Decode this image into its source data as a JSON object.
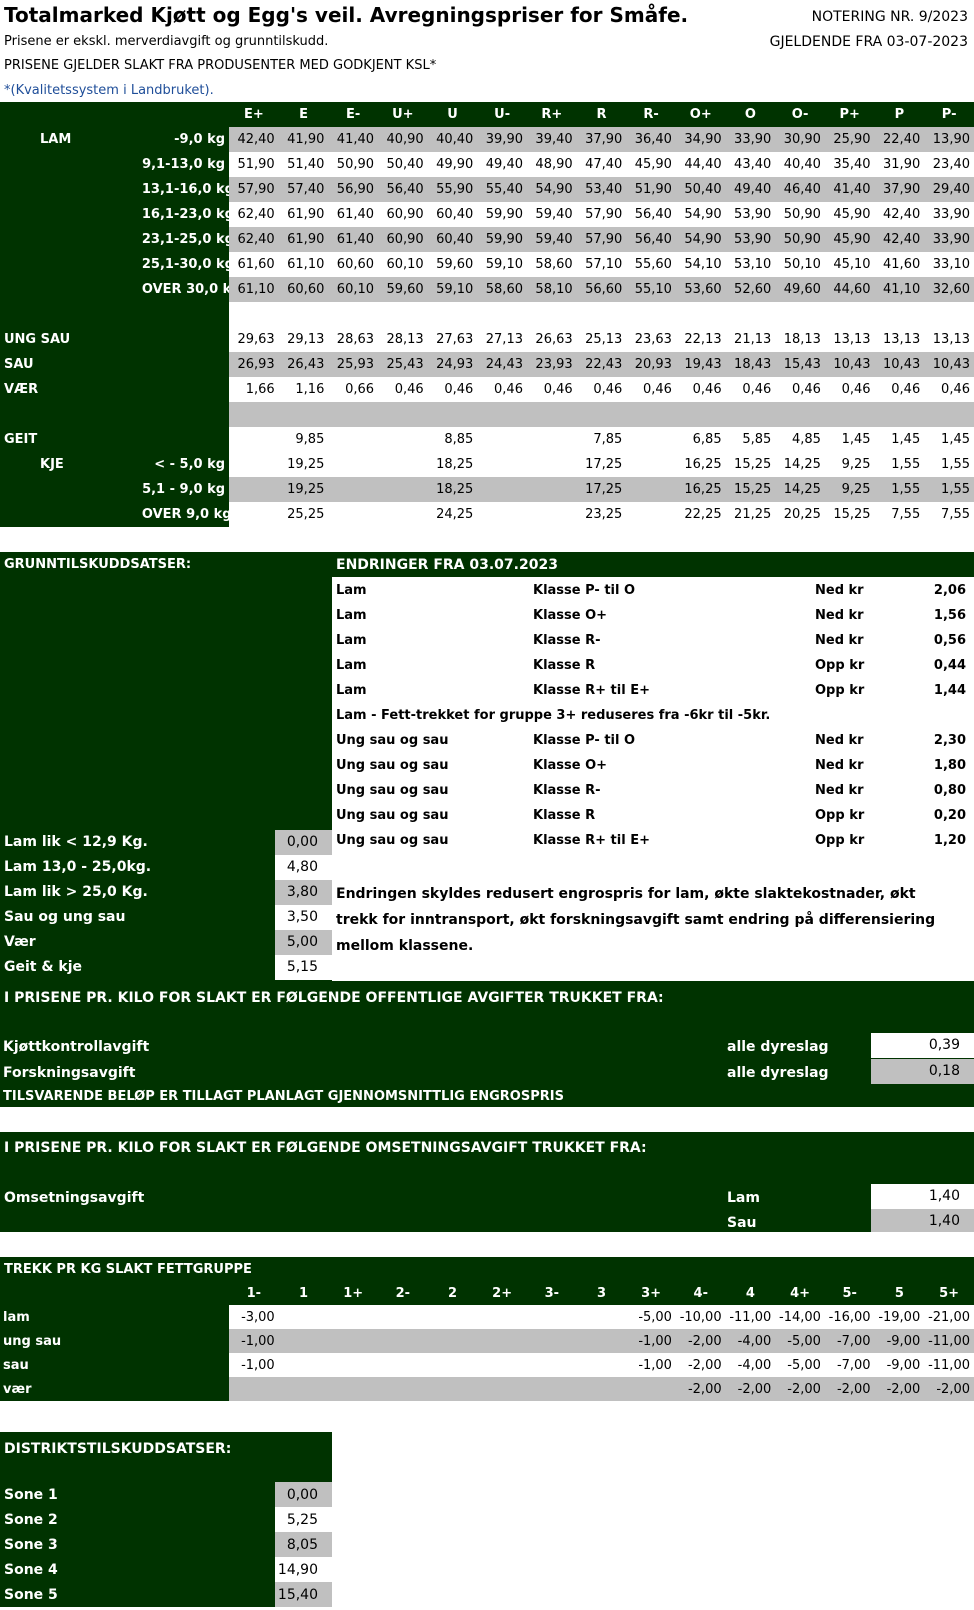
{
  "header": {
    "title": "Totalmarked Kjøtt og Egg's veil. Avregningspriser for Småfe.",
    "notering": "NOTERING NR. 9/2023",
    "gjeldende": "GJELDENDE FRA 03-07-2023",
    "sub1": "Prisene er ekskl. merverdiavgift og grunntilskudd.",
    "sub2": "PRISENE GJELDER SLAKT FRA PRODUSENTER MED GODKJENT KSL*",
    "sub3": "*(Kvalitetssystem i Landbruket)."
  },
  "prices": {
    "classes": [
      "E+",
      "E",
      "E-",
      "U+",
      "U",
      "U-",
      "R+",
      "R",
      "R-",
      "O+",
      "O",
      "O-",
      "P+",
      "P",
      "P-"
    ],
    "rows": [
      {
        "l1": "LAM",
        "l2": "-9,0 kg",
        "grey": true,
        "v": [
          "42,40",
          "41,90",
          "41,40",
          "40,90",
          "40,40",
          "39,90",
          "39,40",
          "37,90",
          "36,40",
          "34,90",
          "33,90",
          "30,90",
          "25,90",
          "22,40",
          "13,90"
        ]
      },
      {
        "l1": "",
        "l2": "9,1-13,0 kg",
        "grey": false,
        "v": [
          "51,90",
          "51,40",
          "50,90",
          "50,40",
          "49,90",
          "49,40",
          "48,90",
          "47,40",
          "45,90",
          "44,40",
          "43,40",
          "40,40",
          "35,40",
          "31,90",
          "23,40"
        ]
      },
      {
        "l1": "",
        "l2": "13,1-16,0 kg",
        "grey": true,
        "v": [
          "57,90",
          "57,40",
          "56,90",
          "56,40",
          "55,90",
          "55,40",
          "54,90",
          "53,40",
          "51,90",
          "50,40",
          "49,40",
          "46,40",
          "41,40",
          "37,90",
          "29,40"
        ]
      },
      {
        "l1": "",
        "l2": "16,1-23,0 kg",
        "grey": false,
        "v": [
          "62,40",
          "61,90",
          "61,40",
          "60,90",
          "60,40",
          "59,90",
          "59,40",
          "57,90",
          "56,40",
          "54,90",
          "53,90",
          "50,90",
          "45,90",
          "42,40",
          "33,90"
        ]
      },
      {
        "l1": "",
        "l2": "23,1-25,0 kg",
        "grey": true,
        "v": [
          "62,40",
          "61,90",
          "61,40",
          "60,90",
          "60,40",
          "59,90",
          "59,40",
          "57,90",
          "56,40",
          "54,90",
          "53,90",
          "50,90",
          "45,90",
          "42,40",
          "33,90"
        ]
      },
      {
        "l1": "",
        "l2": "25,1-30,0 kg",
        "grey": false,
        "v": [
          "61,60",
          "61,10",
          "60,60",
          "60,10",
          "59,60",
          "59,10",
          "58,60",
          "57,10",
          "55,60",
          "54,10",
          "53,10",
          "50,10",
          "45,10",
          "41,60",
          "33,10"
        ]
      },
      {
        "l1": "",
        "l2": "OVER 30,0 kg",
        "grey": true,
        "v": [
          "61,10",
          "60,60",
          "60,10",
          "59,60",
          "59,10",
          "58,60",
          "58,10",
          "56,60",
          "55,10",
          "53,60",
          "52,60",
          "49,60",
          "44,60",
          "41,10",
          "32,60"
        ]
      },
      {
        "l1": "",
        "l2": "",
        "grey": false,
        "v": [
          "",
          "",
          "",
          "",
          "",
          "",
          "",
          "",
          "",
          "",
          "",
          "",
          "",
          "",
          ""
        ]
      },
      {
        "l1": "UNG SAU",
        "l2": "",
        "grey": false,
        "v": [
          "29,63",
          "29,13",
          "28,63",
          "28,13",
          "27,63",
          "27,13",
          "26,63",
          "25,13",
          "23,63",
          "22,13",
          "21,13",
          "18,13",
          "13,13",
          "13,13",
          "13,13"
        ]
      },
      {
        "l1": "SAU",
        "l2": "",
        "grey": true,
        "v": [
          "26,93",
          "26,43",
          "25,93",
          "25,43",
          "24,93",
          "24,43",
          "23,93",
          "22,43",
          "20,93",
          "19,43",
          "18,43",
          "15,43",
          "10,43",
          "10,43",
          "10,43"
        ]
      },
      {
        "l1": "VÆR",
        "l2": "",
        "grey": false,
        "v": [
          "1,66",
          "1,16",
          "0,66",
          "0,46",
          "0,46",
          "0,46",
          "0,46",
          "0,46",
          "0,46",
          "0,46",
          "0,46",
          "0,46",
          "0,46",
          "0,46",
          "0,46"
        ]
      },
      {
        "l1": "",
        "l2": "",
        "grey": true,
        "v": [
          "",
          "",
          "",
          "",
          "",
          "",
          "",
          "",
          "",
          "",
          "",
          "",
          "",
          "",
          ""
        ]
      },
      {
        "l1": "GEIT",
        "l2": "",
        "grey": false,
        "v": [
          "",
          "9,85",
          "",
          "",
          "8,85",
          "",
          "",
          "7,85",
          "",
          "6,85",
          "5,85",
          "4,85",
          "1,45",
          "1,45",
          "1,45"
        ]
      },
      {
        "l1": "KJE",
        "l2": "< - 5,0 kg",
        "grey": false,
        "v": [
          "",
          "19,25",
          "",
          "",
          "18,25",
          "",
          "",
          "17,25",
          "",
          "16,25",
          "15,25",
          "14,25",
          "9,25",
          "1,55",
          "1,55"
        ]
      },
      {
        "l1": "",
        "l2": "5,1 - 9,0 kg",
        "grey": true,
        "v": [
          "",
          "19,25",
          "",
          "",
          "18,25",
          "",
          "",
          "17,25",
          "",
          "16,25",
          "15,25",
          "14,25",
          "9,25",
          "1,55",
          "1,55"
        ]
      },
      {
        "l1": "",
        "l2": "OVER 9,0 kg",
        "grey": false,
        "v": [
          "",
          "25,25",
          "",
          "",
          "24,25",
          "",
          "",
          "23,25",
          "",
          "22,25",
          "21,25",
          "20,25",
          "15,25",
          "7,55",
          "7,55"
        ]
      }
    ]
  },
  "grunn": {
    "title": "GRUNNTILSKUDDSATSER:",
    "endringer_title": "ENDRINGER FRA 03.07.2023",
    "changes": [
      {
        "a": "Lam",
        "b": "Klasse P- til O",
        "c": "Ned kr",
        "d": "2,06"
      },
      {
        "a": "Lam",
        "b": "Klasse O+",
        "c": "Ned kr",
        "d": "1,56"
      },
      {
        "a": "Lam",
        "b": "Klasse R-",
        "c": "Ned kr",
        "d": "0,56"
      },
      {
        "a": "Lam",
        "b": "Klasse R",
        "c": "Opp kr",
        "d": "0,44"
      },
      {
        "a": "Lam",
        "b": "Klasse R+ til E+",
        "c": "Opp kr",
        "d": "1,44"
      },
      {
        "a": "Lam - Fett-trekket for gruppe 3+ reduseres fra -6kr til -5kr.",
        "b": "",
        "c": "",
        "d": ""
      },
      {
        "a": "Ung sau og sau",
        "b": "Klasse P- til O",
        "c": "Ned kr",
        "d": "2,30"
      },
      {
        "a": "Ung sau og sau",
        "b": "Klasse O+",
        "c": "Ned kr",
        "d": "1,80"
      },
      {
        "a": "Ung sau og sau",
        "b": "Klasse R-",
        "c": "Ned kr",
        "d": "0,80"
      },
      {
        "a": "Ung sau og sau",
        "b": "Klasse R",
        "c": "Opp kr",
        "d": "0,20"
      },
      {
        "a": "Ung sau og sau",
        "b": "Klasse R+ til E+",
        "c": "Opp kr",
        "d": "1,20"
      }
    ],
    "rates": [
      {
        "label": "Lam lik < 12,9 Kg.",
        "value": "0,00",
        "grey": true
      },
      {
        "label": "Lam 13,0 - 25,0kg.",
        "value": "4,80",
        "grey": false
      },
      {
        "label": "Lam lik > 25,0 Kg.",
        "value": "3,80",
        "grey": true
      },
      {
        "label": "Sau og ung sau",
        "value": "3,50",
        "grey": false
      },
      {
        "label": "Vær",
        "value": "5,00",
        "grey": true
      },
      {
        "label": "Geit & kje",
        "value": "5,15",
        "grey": false
      }
    ],
    "note_lines": [
      "Endringen skyldes redusert engrospris for lam, økte slaktekostnader, økt",
      "trekk for inntransport, økt forskningsavgift samt endring på differensiering",
      "mellom klassene."
    ]
  },
  "avgifter": {
    "title": "I PRISENE PR. KILO FOR SLAKT ER FØLGENDE OFFENTLIGE AVGIFTER TRUKKET FRA:",
    "rows": [
      {
        "label": "Kjøttkontrollavgift",
        "scope": "alle dyreslag",
        "value": "0,39"
      },
      {
        "label": "Forskningsavgift",
        "scope": "alle dyreslag",
        "value": "0,18"
      }
    ],
    "footer": "TILSVARENDE BELØP ER TILLAGT PLANLAGT GJENNOMSNITTLIG ENGROSPRIS"
  },
  "omsetning": {
    "title": "I PRISENE PR. KILO FOR SLAKT ER FØLGENDE OMSETNINGSAVGIFT TRUKKET FRA:",
    "label": "Omsetningsavgift",
    "rows": [
      {
        "scope": "Lam",
        "value": "1,40"
      },
      {
        "scope": "Sau",
        "value": "1,40"
      }
    ]
  },
  "trekk": {
    "title": "TREKK PR KG SLAKT FETTGRUPPE",
    "groups": [
      "1-",
      "1",
      "1+",
      "2-",
      "2",
      "2+",
      "3-",
      "3",
      "3+",
      "4-",
      "4",
      "4+",
      "5-",
      "5",
      "5+"
    ],
    "rows": [
      {
        "label": "lam",
        "grey": false,
        "v": [
          "-3,00",
          "",
          "",
          "",
          "",
          "",
          "",
          "",
          "-5,00",
          "-10,00",
          "-11,00",
          "-14,00",
          "-16,00",
          "-19,00",
          "-21,00"
        ]
      },
      {
        "label": "ung sau",
        "grey": true,
        "v": [
          "-1,00",
          "",
          "",
          "",
          "",
          "",
          "",
          "",
          "-1,00",
          "-2,00",
          "-4,00",
          "-5,00",
          "-7,00",
          "-9,00",
          "-11,00"
        ]
      },
      {
        "label": "sau",
        "grey": false,
        "v": [
          "-1,00",
          "",
          "",
          "",
          "",
          "",
          "",
          "",
          "-1,00",
          "-2,00",
          "-4,00",
          "-5,00",
          "-7,00",
          "-9,00",
          "-11,00"
        ]
      },
      {
        "label": "vær",
        "grey": true,
        "v": [
          "",
          "",
          "",
          "",
          "",
          "",
          "",
          "",
          "",
          "-2,00",
          "-2,00",
          "-2,00",
          "-2,00",
          "-2,00",
          "-2,00"
        ]
      }
    ]
  },
  "distrikt": {
    "title": "DISTRIKTSTILSKUDDSATSER:",
    "rows": [
      {
        "label": "Sone 1",
        "value": "0,00",
        "grey": true
      },
      {
        "label": "Sone 2",
        "value": "5,25",
        "grey": false
      },
      {
        "label": "Sone 3",
        "value": "8,05",
        "grey": true
      },
      {
        "label": "Sone 4",
        "value": "14,90",
        "grey": false
      },
      {
        "label": "Sone 5",
        "value": "15,40",
        "grey": true
      }
    ]
  }
}
